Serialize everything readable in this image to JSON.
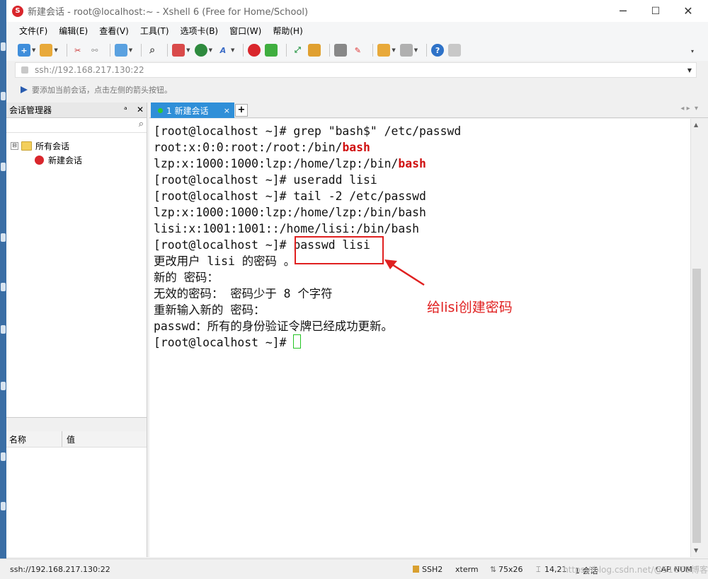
{
  "window": {
    "title": "新建会话 - root@localhost:~ - Xshell 6 (Free for Home/School)",
    "controls": [
      "─",
      "☐",
      "✕"
    ]
  },
  "menu": [
    "文件(F)",
    "编辑(E)",
    "查看(V)",
    "工具(T)",
    "选项卡(B)",
    "窗口(W)",
    "帮助(H)"
  ],
  "address": {
    "value": "ssh://192.168.217.130:22"
  },
  "hint": "要添加当前会话，点击左侧的箭头按钮。",
  "session_manager": {
    "title": "会话管理器",
    "pin": "ᵃ",
    "close": "✕",
    "tree": [
      {
        "label": "所有会话",
        "expander": "⊟"
      },
      {
        "label": "新建会话"
      }
    ],
    "props_columns": [
      "名称",
      "值"
    ]
  },
  "tab": {
    "label": "1 新建会话",
    "close": "×",
    "add": "+"
  },
  "terminal": {
    "lines": [
      {
        "pre": "[root@localhost ~]# grep \"bash$\" /etc/passwd",
        "hl": ""
      },
      {
        "pre": "root:x:0:0:root:/root:/bin/",
        "hl": "bash"
      },
      {
        "pre": "lzp:x:1000:1000:lzp:/home/lzp:/bin/",
        "hl": "bash"
      },
      {
        "pre": "[root@localhost ~]# useradd lisi",
        "hl": ""
      },
      {
        "pre": "[root@localhost ~]# tail -2 /etc/passwd",
        "hl": ""
      },
      {
        "pre": "lzp:x:1000:1000:lzp:/home/lzp:/bin/bash",
        "hl": ""
      },
      {
        "pre": "lisi:x:1001:1001::/home/lisi:/bin/bash",
        "hl": ""
      },
      {
        "pre": "[root@localhost ~]# passwd lisi",
        "hl": ""
      },
      {
        "pre": "更改用户 lisi 的密码 。",
        "hl": ""
      },
      {
        "pre": "新的 密码：",
        "hl": ""
      },
      {
        "pre": "无效的密码： 密码少于 8 个字符",
        "hl": ""
      },
      {
        "pre": "重新输入新的 密码：",
        "hl": ""
      },
      {
        "pre": "passwd：所有的身份验证令牌已经成功更新。",
        "hl": ""
      },
      {
        "pre": "[root@localhost ~]# ",
        "hl": ""
      }
    ],
    "annotation": "给lisi创建密码",
    "colors": {
      "highlight": "#d01010",
      "annotation": "#e02020",
      "cursor": "#24c524"
    }
  },
  "status": {
    "connection": "ssh://192.168.217.130:22",
    "protocol": "SSH2",
    "term": "xterm",
    "size": "75x26",
    "pos": "14,21",
    "sessions": "1 会话",
    "caps": "CAP",
    "num": "NUM",
    "watermark": "https://blog.csdn.net/@51CTO博客"
  }
}
